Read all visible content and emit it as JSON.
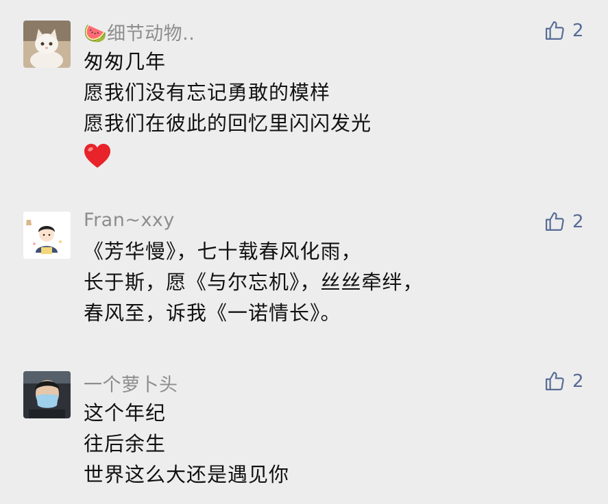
{
  "comments": [
    {
      "name_emoji": "🍉",
      "name": "细节动物..",
      "likes": "2",
      "lines": [
        "匆匆几年",
        "愿我们没有忘记勇敢的模样",
        "愿我们在彼此的回忆里闪闪发光"
      ],
      "emoji": "❤️"
    },
    {
      "name": "Fran~xxy",
      "likes": "2",
      "lines": [
        "《芳华慢》，七十载春风化雨，",
        "长于斯，愿《与尔忘机》，丝丝牵绊，",
        "春风至，诉我《一诺情长》。"
      ]
    },
    {
      "name": "一个萝卜头",
      "likes": "2",
      "lines": [
        "这个年纪",
        "往后余生",
        "世界这么大还是遇见你"
      ]
    }
  ],
  "colors": {
    "background": "#ededed",
    "name": "#8d8d8d",
    "text": "#111111",
    "like": "#576b95"
  }
}
